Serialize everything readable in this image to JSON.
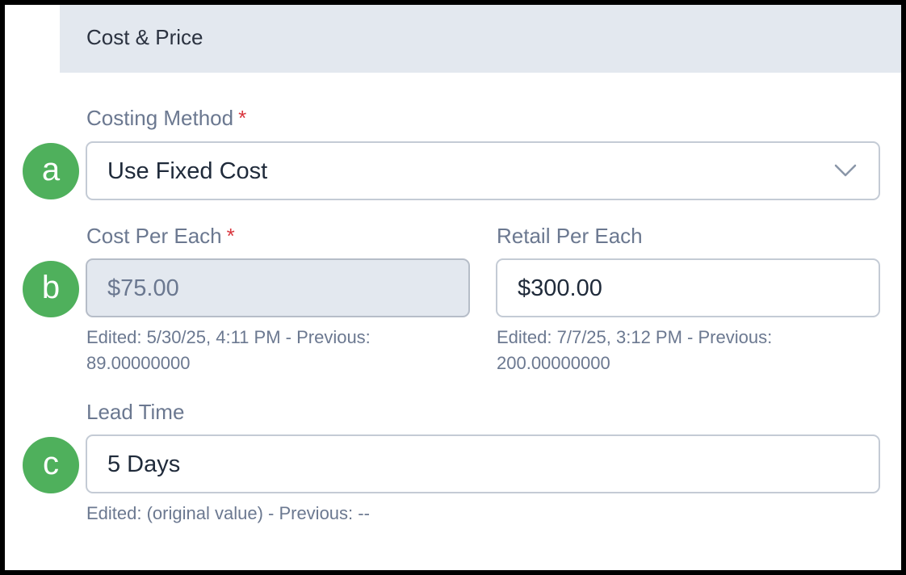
{
  "section": {
    "title": "Cost & Price"
  },
  "costing_method": {
    "label": "Costing Method",
    "required_mark": "*",
    "selected": "Use Fixed Cost",
    "icon": "chevron-down-icon",
    "badge": "a"
  },
  "cost_per_each": {
    "label": "Cost Per Each",
    "required_mark": "*",
    "value": "$75.00",
    "helper_line1": "Edited: 5/30/25, 4:11 PM - Previous:",
    "helper_line2": "89.00000000",
    "badge": "b"
  },
  "retail_per_each": {
    "label": "Retail Per Each",
    "value": "$300.00",
    "helper_line1": "Edited: 7/7/25, 3:12 PM - Previous:",
    "helper_line2": "200.00000000"
  },
  "lead_time": {
    "label": "Lead Time",
    "value": "5 Days",
    "helper": "Edited: (original value) - Previous: --",
    "badge": "c"
  },
  "colors": {
    "header_bg": "#e3e8ef",
    "label": "#6b7890",
    "required": "#d9363e",
    "badge": "#4fb05c",
    "border": "#c4cbd5"
  }
}
